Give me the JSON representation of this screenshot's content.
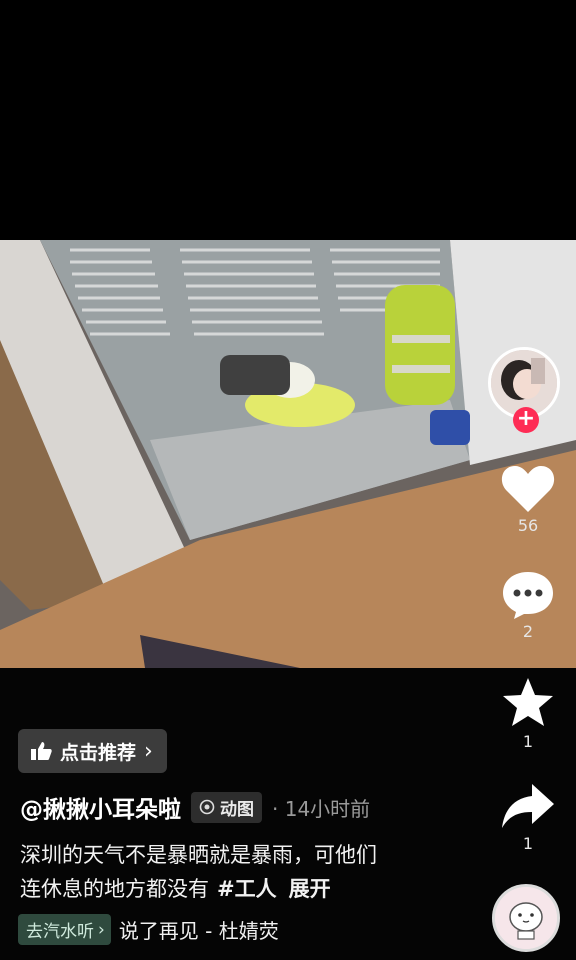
{
  "video": {
    "scene": "photo"
  },
  "actions": {
    "like_count": "56",
    "comment_count": "2",
    "favorite_count": "1",
    "share_count": "1",
    "follow_symbol": "+"
  },
  "recommend": {
    "label": "点击推荐",
    "chevron": "›"
  },
  "author": {
    "name": "@揪揪小耳朵啦",
    "anim_tag": "动图",
    "time": "· 14小时前"
  },
  "description": {
    "text_line1": "深圳的天气不是暴晒就是暴雨，可他们",
    "text_line2": "连休息的地方都没有",
    "hashtag": "#工人",
    "expand": "展开"
  },
  "music": {
    "chip": "去汽水听",
    "chip_chevron": "›",
    "title": "说了再见 - 杜婧荧"
  },
  "colors": {
    "accent": "#fe2c55",
    "background": "#000000"
  }
}
